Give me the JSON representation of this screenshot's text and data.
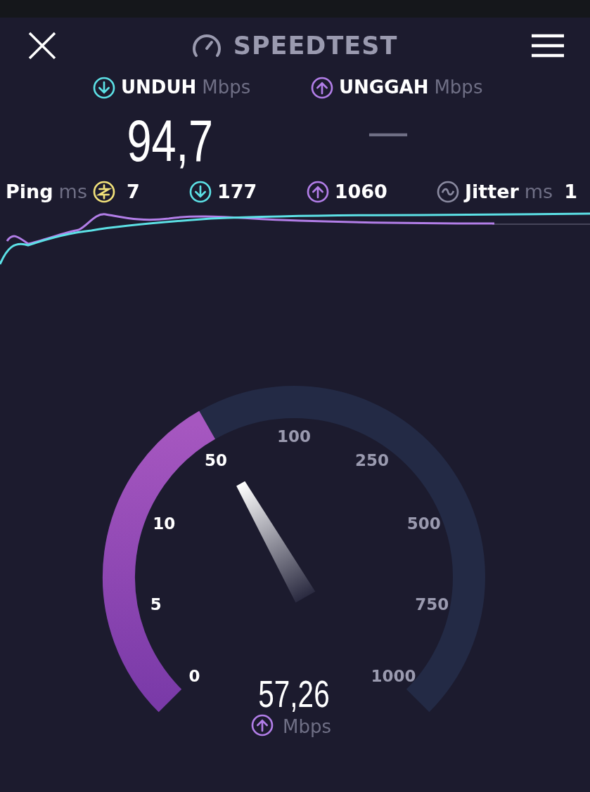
{
  "header": {
    "title": "SPEEDTEST"
  },
  "results": [
    {
      "kind": "download",
      "label": "UNDUH",
      "unit": "Mbps",
      "value": "94,7"
    },
    {
      "kind": "upload",
      "label": "UNGGAH",
      "unit": "Mbps",
      "value": "—"
    }
  ],
  "stats": [
    {
      "kind": "ping",
      "label": "Ping",
      "unit": "ms",
      "value": "7"
    },
    {
      "kind": "download",
      "value": "177"
    },
    {
      "kind": "upload",
      "value": "1060"
    },
    {
      "kind": "jitter",
      "label": "Jitter",
      "unit": "ms",
      "value": "1"
    }
  ],
  "gauge": {
    "ticks": [
      {
        "label": "0",
        "lit": true
      },
      {
        "label": "5",
        "lit": true
      },
      {
        "label": "10",
        "lit": true
      },
      {
        "label": "50",
        "lit": true
      },
      {
        "label": "100",
        "lit": false
      },
      {
        "label": "250",
        "lit": false
      },
      {
        "label": "500",
        "lit": false
      },
      {
        "label": "750",
        "lit": false
      },
      {
        "label": "1000",
        "lit": false
      }
    ],
    "reading": "57,26",
    "kind": "upload",
    "unit": "Mbps"
  }
}
